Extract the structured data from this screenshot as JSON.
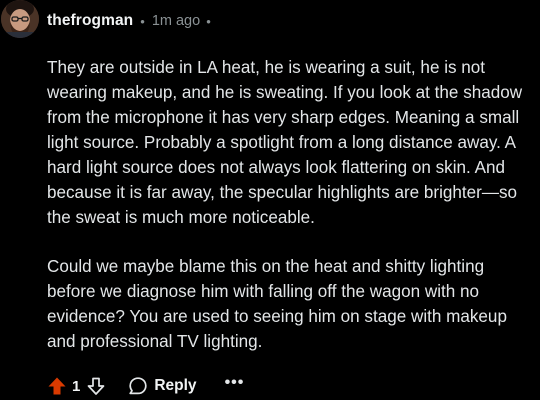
{
  "comment": {
    "username": "thefrogman",
    "separator": "•",
    "timestamp": "1m ago",
    "trailing_dot": "•",
    "paragraphs": [
      "They are outside in LA heat, he is wearing a suit, he is not wearing makeup, and he is sweating. If you look at the shadow from the microphone it has very sharp edges. Meaning a small light source. Probably a spotlight from a long distance away. A hard light source does not always look flattering on skin. And because it is far away, the specular highlights are brighter—so the sweat is much more noticeable.",
      "Could we maybe blame this on the heat and shitty lighting before we diagnose him with falling off the wagon with no evidence? You are used to seeing him on stage with makeup and professional TV lighting."
    ]
  },
  "actions": {
    "score": "1",
    "reply_label": "Reply",
    "more_label": "•••",
    "upvote_icon": "arrow-up-icon",
    "downvote_icon": "arrow-down-icon",
    "reply_icon": "speech-bubble-icon"
  },
  "colors": {
    "background": "#000000",
    "text": "#e3e6e8",
    "meta": "#8a9194",
    "upvote": "#d93a00"
  }
}
